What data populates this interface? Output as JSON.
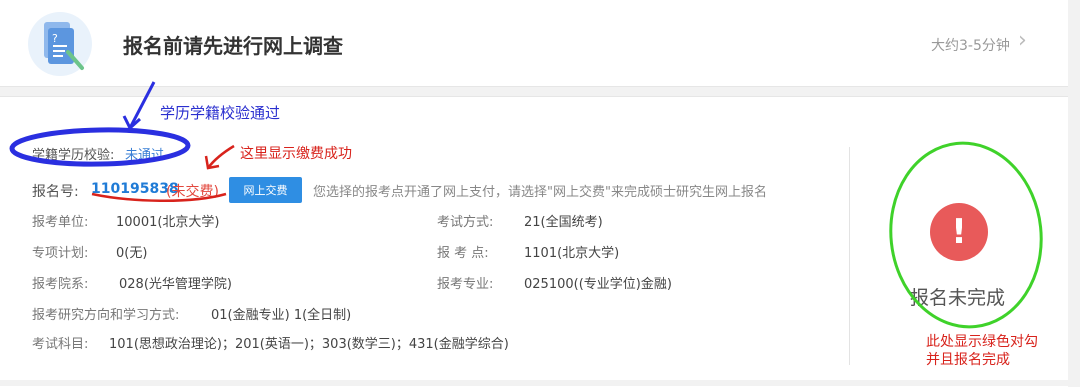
{
  "survey": {
    "title": "报名前请先进行网上调查",
    "duration": "大约3-5分钟",
    "icon": "survey-document-icon"
  },
  "verification": {
    "label": "学籍学历校验:",
    "status": "未通过"
  },
  "registration": {
    "number_label": "报名号:",
    "number": "110195838",
    "payment_status": "(未交费)",
    "pay_button": "网上交费",
    "notice": "您选择的报考点开通了网上支付，请选择\"网上交费\"来完成硕士研究生网上报名"
  },
  "fields": {
    "unit_label": "报考单位:",
    "unit_value": "10001(北京大学)",
    "exam_method_label": "考试方式:",
    "exam_method_value": "21(全国统考)",
    "special_plan_label": "专项计划:",
    "special_plan_value": "0(无)",
    "exam_site_label": "报 考 点:",
    "exam_site_value": "1101(北京大学)",
    "department_label": "报考院系:",
    "department_value": "028(光华管理学院)",
    "major_label": "报考专业:",
    "major_value": "025100((专业学位)金融)",
    "direction_label": "报考研究方向和学习方式:",
    "direction_value": "01(金融专业) 1(全日制)",
    "subjects_label": "考试科目:",
    "subjects_value": "101(思想政治理论)；201(英语一)；303(数学三)；431(金融学综合)"
  },
  "status_panel": {
    "text": "报名未完成",
    "icon": "exclamation-icon",
    "color": "#e85a5a"
  },
  "annotations": {
    "verify_passed": "学历学籍校验通过",
    "payment_success": "这里显示缴费成功",
    "green_check_line1": "此处显示绿色对勾",
    "green_check_line2": "并且报名完成"
  }
}
